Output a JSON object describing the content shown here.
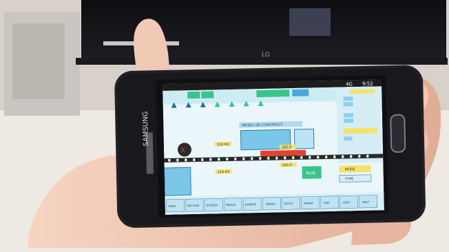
{
  "photo": {
    "monitor_brand": "LG",
    "phone_brand": "SAMSUNG"
  },
  "status_bar": {
    "time": "9:52",
    "network": "4G"
  },
  "app": {
    "section_title": "MODEL DE CONSTRUCT",
    "wheel_tag": "X",
    "labels": {
      "speed_1": "110 KV",
      "speed_2": "110 KV",
      "center_bar": "185.0",
      "lower_bar": "240.0"
    },
    "buttons": {
      "right_primary": "MODE",
      "right_secondary": "TYPE",
      "bottom_green": "RUN"
    },
    "bottom_nav": [
      "MAIN",
      "SECTION",
      "SCREEN",
      "DEVICE",
      "ALARMS",
      "TREND",
      "SETUP",
      "PARAM",
      "HIST",
      "LOGS",
      "HELP"
    ]
  },
  "colors": {
    "screen_bg": "#eaf6fa",
    "accent_green": "#39c48b",
    "accent_red": "#e2432f",
    "accent_yellow": "#f4e26a",
    "accent_blue": "#4ca7d8"
  }
}
